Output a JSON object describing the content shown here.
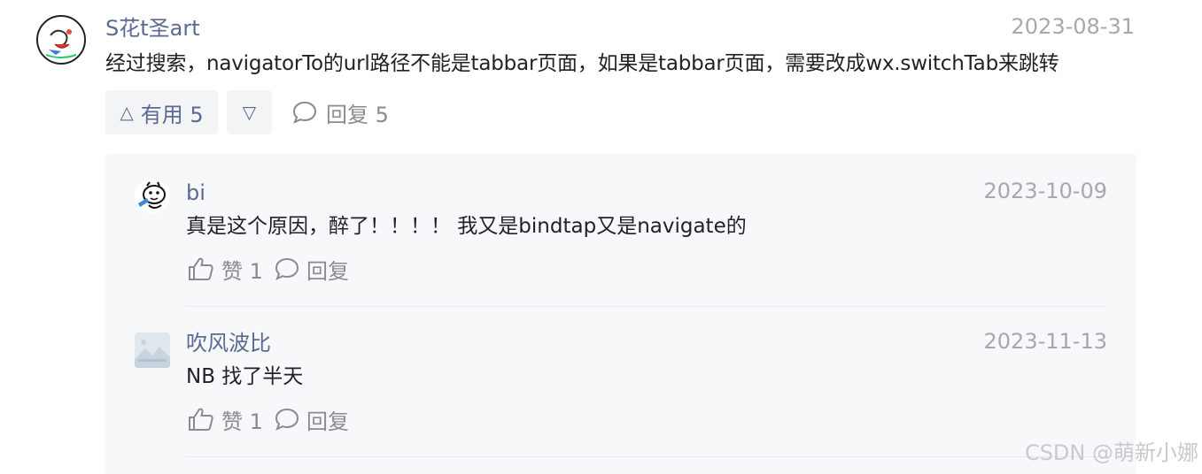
{
  "comment": {
    "author": "S花t圣art",
    "date": "2023-08-31",
    "text": "经过搜索，navigatorTo的url路径不能是tabbar页面，如果是tabbar页面，需要改成wx.switchTab来跳转",
    "upvote_label": "有用 5",
    "reply_label": "回复 5"
  },
  "replies": [
    {
      "author": "bi",
      "date": "2023-10-09",
      "text": "真是这个原因，醉了！！！！ 我又是bindtap又是navigate的",
      "like_label": "赞 1",
      "reply_label": "回复"
    },
    {
      "author": "吹风波比",
      "date": "2023-11-13",
      "text": "NB 找了半天",
      "like_label": "赞 1",
      "reply_label": "回复"
    }
  ],
  "watermark": "CSDN @萌新小娜"
}
